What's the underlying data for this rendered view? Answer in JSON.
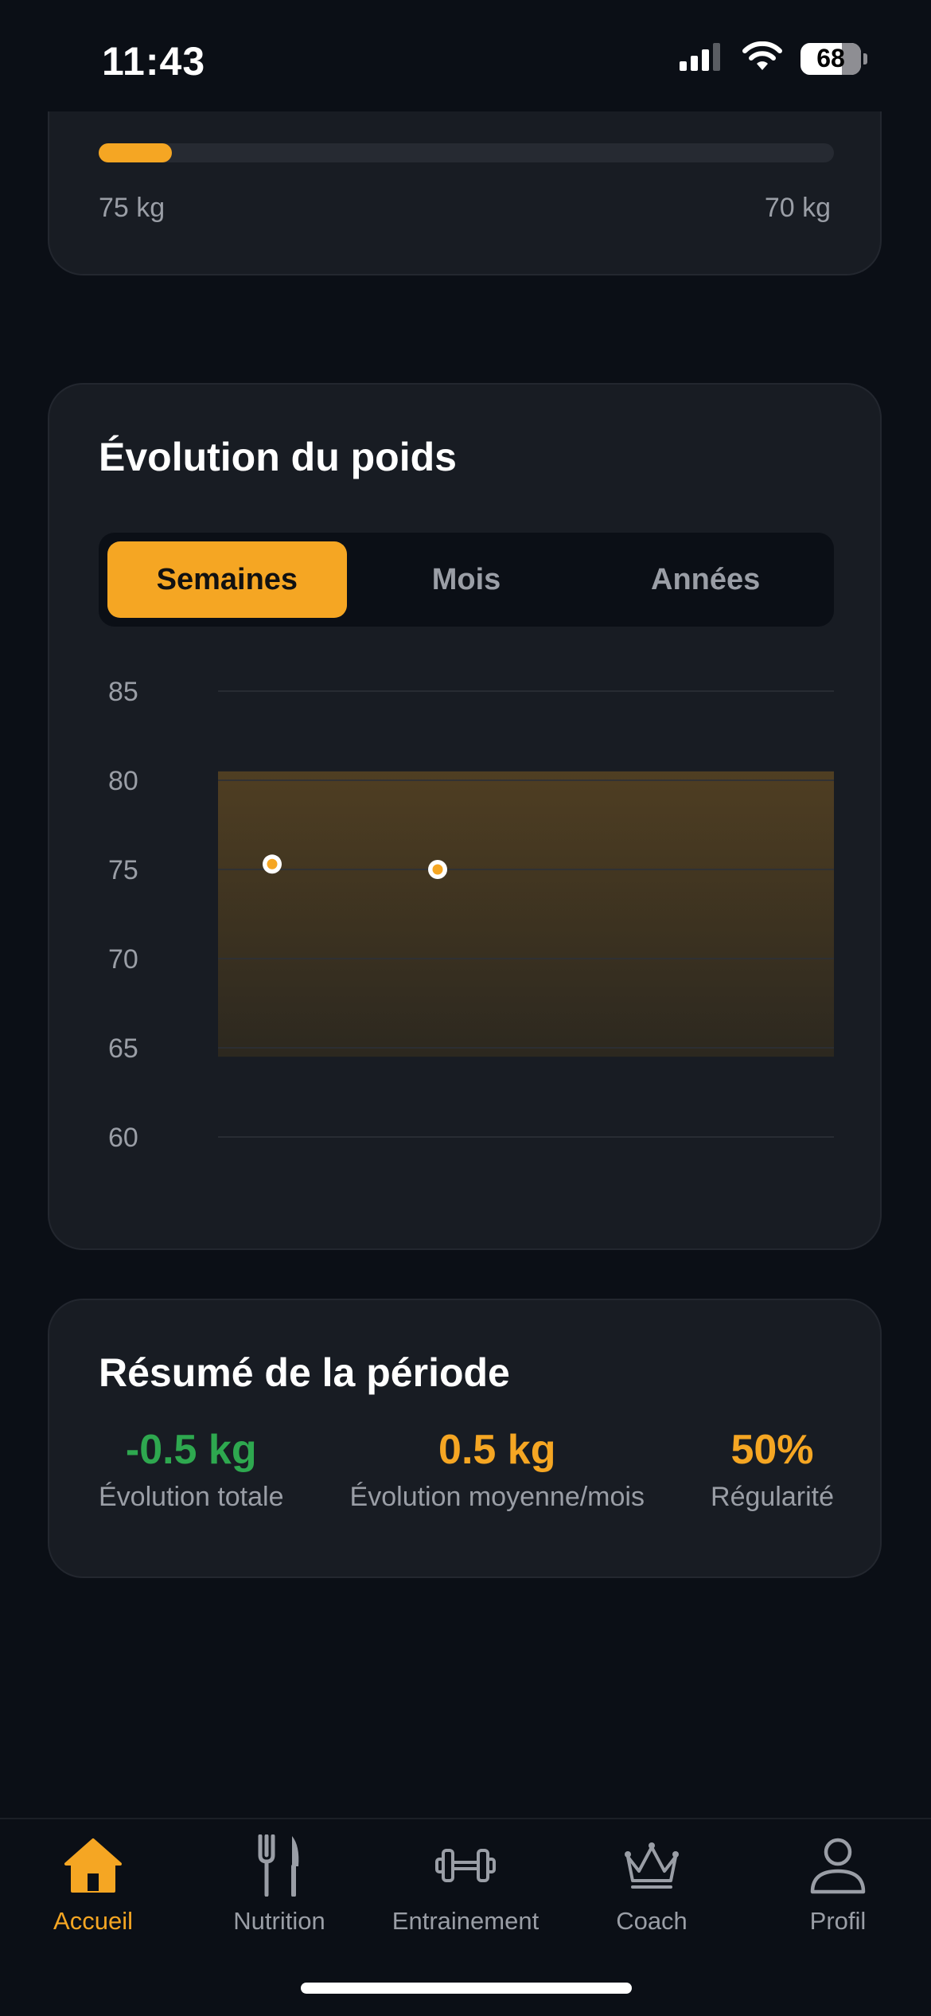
{
  "status_bar": {
    "time": "11:43",
    "battery": "68",
    "battery_level": 0.68
  },
  "goal_progress": {
    "start_label": "75 kg",
    "target_label": "70 kg",
    "progress_fraction": 0.1
  },
  "weight_chart": {
    "title": "Évolution du poids",
    "tabs": [
      {
        "label": "Semaines",
        "active": true
      },
      {
        "label": "Mois",
        "active": false
      },
      {
        "label": "Années",
        "active": false
      }
    ]
  },
  "chart_data": {
    "type": "scatter",
    "title": "Évolution du poids",
    "xlabel": "",
    "ylabel": "",
    "ylim": [
      60,
      85
    ],
    "y_ticks": [
      85,
      80,
      75,
      70,
      65,
      60
    ],
    "band": [
      64.5,
      80.5
    ],
    "points": [
      {
        "x": 1,
        "y": 75.3
      },
      {
        "x": 2,
        "y": 75
      }
    ],
    "grid": true,
    "colors": {
      "band": "#4f3e22",
      "point_fill": "#f5a623",
      "point_ring": "#ffffff",
      "gridline": "#2c3038"
    }
  },
  "summary": {
    "title": "Résumé de la période",
    "stats": [
      {
        "value": "-0.5 kg",
        "label": "Évolution totale",
        "color": "#2ea84f"
      },
      {
        "value": "0.5 kg",
        "label": "Évolution moyenne/mois",
        "color": "#f5a623"
      },
      {
        "value": "50%",
        "label": "Régularité",
        "color": "#f5a623"
      }
    ]
  },
  "tab_bar": {
    "items": [
      {
        "label": "Accueil",
        "icon": "home-icon",
        "active": true
      },
      {
        "label": "Nutrition",
        "icon": "fork-knife-icon",
        "active": false
      },
      {
        "label": "Entrainement",
        "icon": "dumbbell-icon",
        "active": false
      },
      {
        "label": "Coach",
        "icon": "crown-icon",
        "active": false
      },
      {
        "label": "Profil",
        "icon": "person-icon",
        "active": false
      }
    ]
  },
  "colors": {
    "accent": "#f5a623",
    "background": "#0b0f16",
    "card": "#181c23",
    "muted_text": "#9a9ea6",
    "positive": "#2ea84f"
  }
}
